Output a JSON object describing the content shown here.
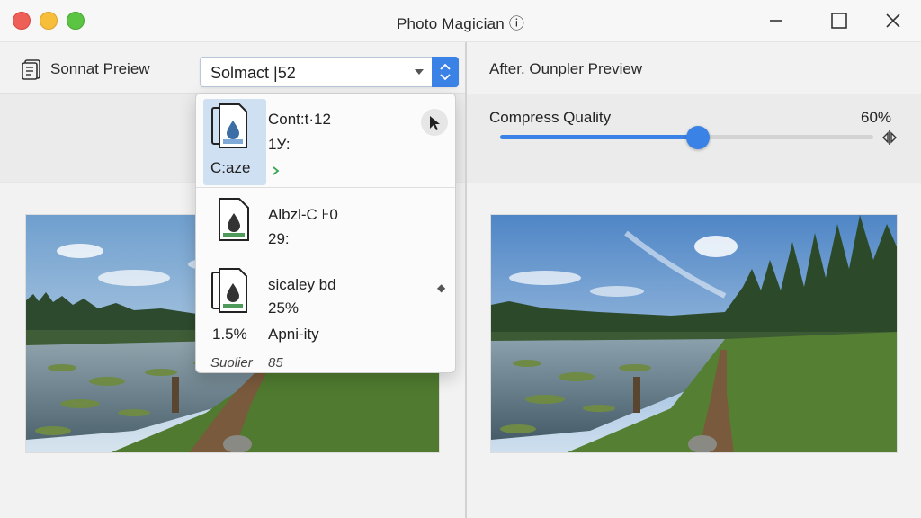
{
  "window": {
    "title": "Photo Magician ⓘ"
  },
  "left_pane": {
    "title": "Sonnat Preiew",
    "select": {
      "value": "Solmact |52"
    }
  },
  "dropdown": {
    "items": [
      {
        "caption": "C:aze",
        "line1": "Cont:t·12",
        "line2": "1У:"
      },
      {
        "line1": "Albzl-C ⊦0",
        "line2": "29:"
      },
      {
        "line1": "sicaley bd",
        "line2": "25%",
        "left_value": "1.5%",
        "right_value": "Apni-ity"
      },
      {
        "line1": "Suolier",
        "line2": "85"
      }
    ]
  },
  "right_pane": {
    "title": "After. Ounpler Preview",
    "slider": {
      "label": "Compress Quality",
      "value_text": "60%",
      "value": 0.53
    }
  },
  "colors": {
    "accent": "#3b82e6",
    "selected_item_bg": "#cfe0f2",
    "arrow": "#3aa757"
  },
  "icons": [
    "layers-icon",
    "document-icon",
    "cursor-icon",
    "minimize-icon",
    "maximize-icon",
    "close-icon",
    "chevron-down-icon",
    "spin-arrows-icon",
    "compare-icon"
  ]
}
